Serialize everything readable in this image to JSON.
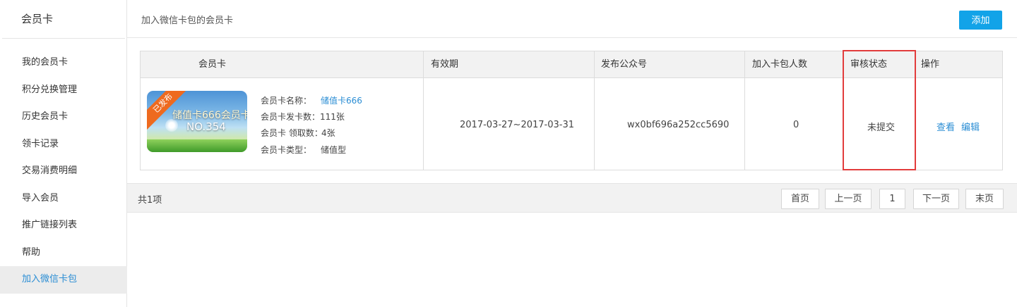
{
  "sidebar": {
    "title": "会员卡",
    "items": [
      {
        "label": "我的会员卡"
      },
      {
        "label": "积分兑换管理"
      },
      {
        "label": "历史会员卡"
      },
      {
        "label": "领卡记录"
      },
      {
        "label": "交易消费明细"
      },
      {
        "label": "导入会员"
      },
      {
        "label": "推广链接列表"
      },
      {
        "label": "帮助"
      },
      {
        "label": "加入微信卡包"
      }
    ],
    "active_index": 8
  },
  "header": {
    "breadcrumb": "加入微信卡包的会员卡",
    "add_label": "添加"
  },
  "table": {
    "columns": [
      "会员卡",
      "有效期",
      "发布公众号",
      "加入卡包人数",
      "审核状态",
      "操作"
    ],
    "row": {
      "card_ribbon": "已发布",
      "card_title": "储值卡666会员卡",
      "card_no": "NO.354",
      "name_label": "会员卡名称：",
      "name_value": "储值卡666",
      "issued_label": "会员卡发卡数：",
      "issued_value": "111张",
      "claimed_label": "会员卡 领取数：",
      "claimed_value": "4张",
      "type_label": "会员卡类型：",
      "type_value": "储值型",
      "validity": "2017-03-27~2017-03-31",
      "account": "wx0bf696a252cc5690",
      "members": "0",
      "status": "未提交",
      "action_view": "查看",
      "action_edit": "编辑"
    }
  },
  "footer": {
    "total": "共1项",
    "first": "首页",
    "prev": "上一页",
    "page": "1",
    "next": "下一页",
    "last": "末页"
  },
  "colors": {
    "accent": "#12a3e8",
    "link": "#2a8dd4",
    "highlight": "#e23c3c"
  }
}
